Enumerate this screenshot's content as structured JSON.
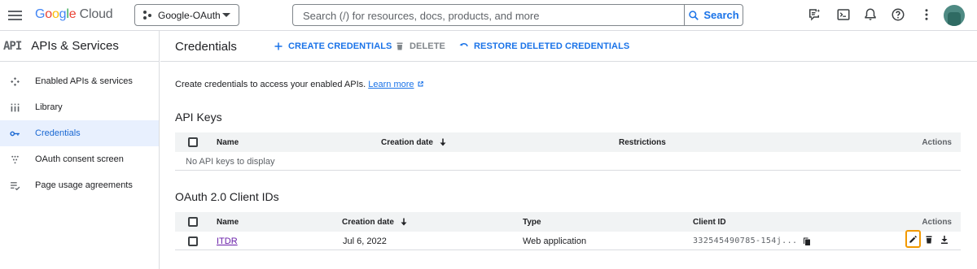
{
  "topbar": {
    "logo_parts": [
      "G",
      "o",
      "o",
      "g",
      "l",
      "e"
    ],
    "logo_cloud": "Cloud",
    "project": "Google-OAuth",
    "search_placeholder": "Search (/) for resources, docs, products, and more",
    "search_button": "Search",
    "icons": [
      "menu-icon",
      "project-icon",
      "search-icon",
      "feedback-icon",
      "cloud-shell-icon",
      "notifications-icon",
      "help-icon",
      "more-vert-icon",
      "avatar"
    ]
  },
  "sidebar": {
    "product_abbr": "API",
    "title": "APIs & Services",
    "items": [
      {
        "label": "Enabled APIs & services",
        "icon": "apis-icon",
        "active": false
      },
      {
        "label": "Library",
        "icon": "library-icon",
        "active": false
      },
      {
        "label": "Credentials",
        "icon": "key-icon",
        "active": true
      },
      {
        "label": "OAuth consent screen",
        "icon": "consent-icon",
        "active": false
      },
      {
        "label": "Page usage agreements",
        "icon": "agreements-icon",
        "active": false
      }
    ]
  },
  "header": {
    "title": "Credentials",
    "create": "CREATE CREDENTIALS",
    "delete": "DELETE",
    "restore": "RESTORE DELETED CREDENTIALS"
  },
  "intro": {
    "text": "Create credentials to access your enabled APIs.",
    "link": "Learn more"
  },
  "api_keys": {
    "title": "API Keys",
    "columns": {
      "name": "Name",
      "creation_date": "Creation date",
      "restrictions": "Restrictions",
      "actions": "Actions"
    },
    "empty": "No API keys to display"
  },
  "oauth": {
    "title": "OAuth 2.0 Client IDs",
    "columns": {
      "name": "Name",
      "creation_date": "Creation date",
      "type": "Type",
      "client_id": "Client ID",
      "actions": "Actions"
    },
    "rows": [
      {
        "name": "ITDR",
        "creation_date": "Jul 6, 2022",
        "type": "Web application",
        "client_id": "332545490785-154j..."
      }
    ]
  },
  "colors": {
    "accent": "#1a73e8",
    "active_bg": "#e8f0fe",
    "highlight": "#f29900",
    "visited_link": "#681da8"
  }
}
